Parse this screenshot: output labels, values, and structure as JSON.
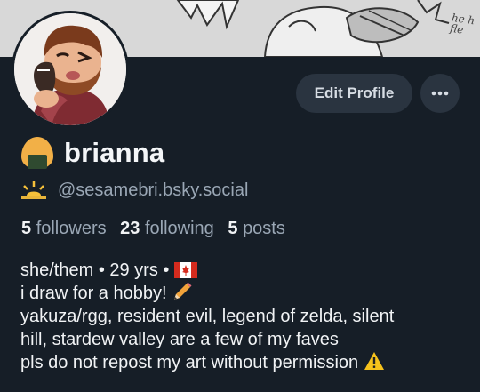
{
  "banner": {
    "handwriting": "he h fle",
    "style": "grayscale comic art"
  },
  "avatar": {
    "alt": "brianna avatar",
    "style": "cartoon portrait"
  },
  "actions": {
    "edit_profile": "Edit Profile",
    "more": "more-options-icon"
  },
  "profile": {
    "display_name": "brianna",
    "name_emoji": "rice-ball-emoji",
    "handle": "@sesamebri.bsky.social",
    "handle_emoji": "sunrise-emoji"
  },
  "stats": {
    "followers_count": "5",
    "followers_label": "followers",
    "following_count": "23",
    "following_label": "following",
    "posts_count": "5",
    "posts_label": "posts"
  },
  "bio": {
    "line1": "she/them • 29 yrs •",
    "line1_flag": "canada-flag-emoji",
    "line2": "i draw for a hobby!",
    "line2_emoji": "pencil-emoji",
    "line3": "yakuza/rgg, resident evil, legend of zelda, silent",
    "line4": "hill, stardew valley are a few of my faves",
    "line5": "pls do not repost my art without permission",
    "line5_emoji": "warning-emoji"
  },
  "colors": {
    "background": "#161e27",
    "button_bg": "#2a3440",
    "muted_text": "#9aa7b5",
    "text": "#f1f3f5"
  }
}
